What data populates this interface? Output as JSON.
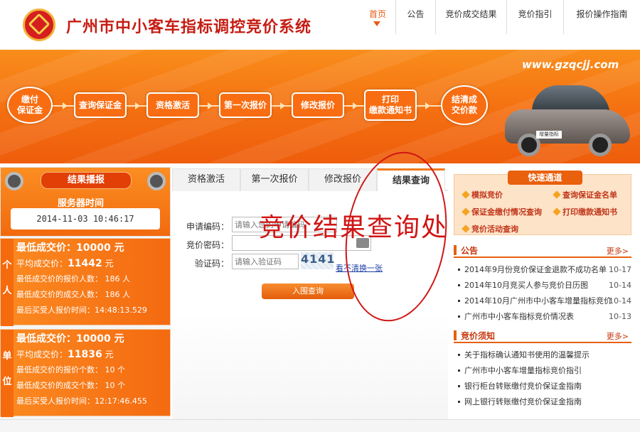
{
  "header": {
    "site_title": "广州市中小客车指标调控竞价系统",
    "nav": [
      "首页",
      "公告",
      "竞价成交结果",
      "竞价指引",
      "报价操作指南"
    ]
  },
  "banner": {
    "url": "www.gzqcjj.com",
    "steps": [
      "缴付\n保证金",
      "查询保证金",
      "资格激活",
      "第一次报价",
      "修改报价",
      "打印\n缴款通知书",
      "结清成\n交价款"
    ],
    "car_plate": "增量指标"
  },
  "left": {
    "title": "结果播报",
    "server_time_label": "服务器时间",
    "server_time": "2014-11-03 10:46:17",
    "personal": {
      "side": "个人",
      "lowest": "最低成交价：10000 元",
      "avg_label": "平均成交价：",
      "avg_value": "11442",
      "avg_unit": "元",
      "low_bid_count": "最低成交价的报价人数： 186 人",
      "low_deal_count": "最低成交价的成交人数： 186 人",
      "last_time": "最后买受人报价时间：14:48:13.529"
    },
    "unit": {
      "side": "单位",
      "lowest": "最低成交价：10000 元",
      "avg_label": "平均成交价：",
      "avg_value": "11836",
      "avg_unit": "元",
      "low_bid_count": "最低成交价的报价个数： 10 个",
      "low_deal_count": "最低成交价的成交个数： 10 个",
      "last_time": "最后买受人报价时间：12:17:46.455"
    }
  },
  "center": {
    "tabs": [
      "资格激活",
      "第一次报价",
      "修改报价",
      "结果查询"
    ],
    "active_tab": "结果查询",
    "form": {
      "app_code_label": "申请编码：",
      "app_code_placeholder": "请输入您的申请编码",
      "password_label": "竞价密码：",
      "captcha_label": "验证码：",
      "captcha_placeholder": "请输入验证码",
      "captcha_value": "4141",
      "refresh_link": "看不清换一张",
      "submit": "入围查询"
    },
    "annotation": "竞价结果查询处"
  },
  "right": {
    "fast_title": "快速通道",
    "fast_links": [
      "模拟竞价",
      "查询保证金名单",
      "保证金缴付情况查询",
      "打印缴款通知书",
      "竞价活动查询"
    ],
    "notice": {
      "title": "公告",
      "more": "更多>",
      "items": [
        {
          "text": "2014年9月份竞价保证金退款不成功名单",
          "date": "10-17"
        },
        {
          "text": "2014年10月竞买人参与竞价日历图",
          "date": "10-14"
        },
        {
          "text": "2014年10月广州市中小客车增量指标竞价",
          "date": "10-14"
        },
        {
          "text": "广州市中小客车指标竞价情况表",
          "date": "10-13"
        }
      ]
    },
    "guide": {
      "title": "竞价须知",
      "more": "更多>",
      "items": [
        "关于指标确认通知书使用的温馨提示",
        "广州市中小客车增量指标竞价指引",
        "银行柜台转账缴付竞价保证金指南",
        "网上银行转账缴付竞价保证金指南"
      ]
    }
  }
}
